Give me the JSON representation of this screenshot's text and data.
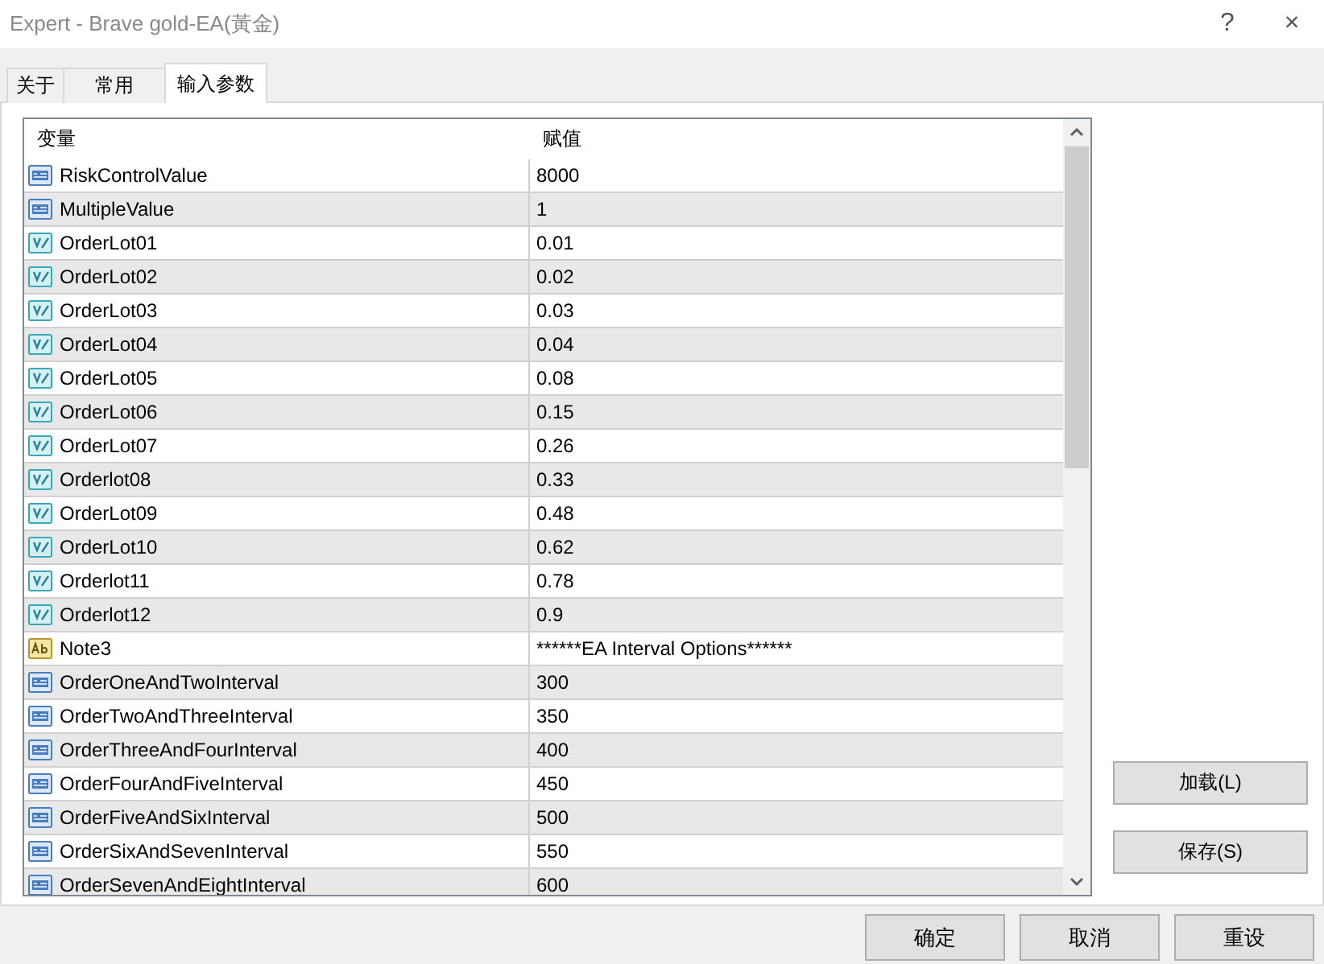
{
  "window": {
    "title": "Expert - Brave gold-EA(黃金)",
    "help": "?",
    "close": "×"
  },
  "tabs": [
    {
      "label": "关于",
      "selected": false
    },
    {
      "label": "常用",
      "selected": false
    },
    {
      "label": "输入参数",
      "selected": true
    }
  ],
  "table": {
    "columns": [
      "变量",
      "赋值"
    ],
    "rows": [
      {
        "kind": "int",
        "name": "RiskControlValue",
        "value": "8000"
      },
      {
        "kind": "int",
        "name": "MultipleValue",
        "value": "1"
      },
      {
        "kind": "double",
        "name": "OrderLot01",
        "value": "0.01"
      },
      {
        "kind": "double",
        "name": "OrderLot02",
        "value": "0.02"
      },
      {
        "kind": "double",
        "name": "OrderLot03",
        "value": "0.03"
      },
      {
        "kind": "double",
        "name": "OrderLot04",
        "value": "0.04"
      },
      {
        "kind": "double",
        "name": "OrderLot05",
        "value": "0.08"
      },
      {
        "kind": "double",
        "name": "OrderLot06",
        "value": "0.15"
      },
      {
        "kind": "double",
        "name": "OrderLot07",
        "value": "0.26"
      },
      {
        "kind": "double",
        "name": "Orderlot08",
        "value": "0.33"
      },
      {
        "kind": "double",
        "name": "OrderLot09",
        "value": "0.48"
      },
      {
        "kind": "double",
        "name": "OrderLot10",
        "value": "0.62"
      },
      {
        "kind": "double",
        "name": "Orderlot11",
        "value": "0.78"
      },
      {
        "kind": "double",
        "name": "Orderlot12",
        "value": "0.9"
      },
      {
        "kind": "string",
        "name": "Note3",
        "value": "******EA Interval Options******"
      },
      {
        "kind": "int",
        "name": "OrderOneAndTwoInterval",
        "value": "300"
      },
      {
        "kind": "int",
        "name": "OrderTwoAndThreeInterval",
        "value": "350"
      },
      {
        "kind": "int",
        "name": "OrderThreeAndFourInterval",
        "value": "400"
      },
      {
        "kind": "int",
        "name": "OrderFourAndFiveInterval",
        "value": "450"
      },
      {
        "kind": "int",
        "name": "OrderFiveAndSixInterval",
        "value": "500"
      },
      {
        "kind": "int",
        "name": "OrderSixAndSevenInterval",
        "value": "550"
      },
      {
        "kind": "int",
        "name": "OrderSevenAndEightInterval",
        "value": "600"
      }
    ]
  },
  "side_buttons": [
    "加载(L)",
    "保存(S)"
  ],
  "buttons": [
    "确定",
    "取消",
    "重设"
  ]
}
